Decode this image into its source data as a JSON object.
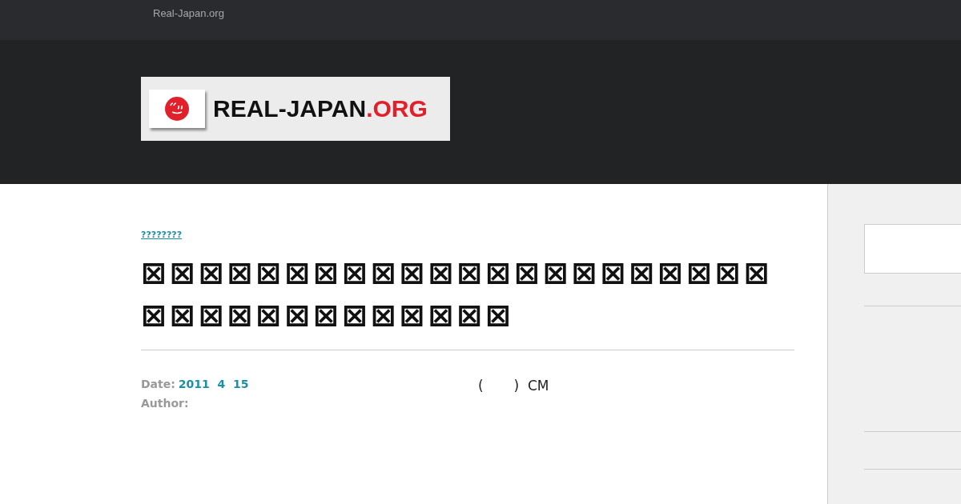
{
  "top_bar": {
    "site_link": "Real-Japan.org"
  },
  "logo": {
    "name": "REAL-JAPAN",
    "suffix": ".ORG"
  },
  "post": {
    "category": "????????",
    "title": "⊠⊠⊠⊠⊠⊠⊠⊠⊠⊠⊠⊠⊠⊠⊠⊠⊠⊠⊠⊠⊠⊠⊠⊠⊠⊠⊠⊠⊠⊠⊠⊠⊠⊠⊠",
    "date_label": "Date:",
    "date": "2011  4  15",
    "author_label": "Author:",
    "note": "(       )  CM"
  }
}
